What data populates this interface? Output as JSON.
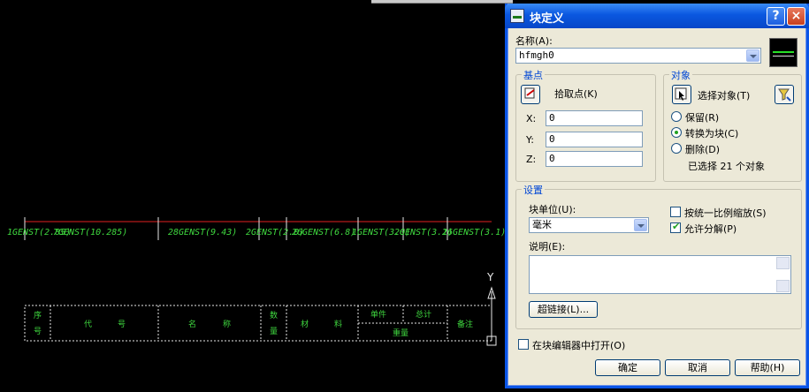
{
  "dialog": {
    "title": "块定义",
    "help_glyph": "?",
    "close_glyph": "×",
    "name_label": "名称(A):",
    "name_value": "hfmgh0",
    "base_point": {
      "title": "基点",
      "pick_label": "拾取点(K)",
      "x_label": "X:",
      "x_value": "0",
      "y_label": "Y:",
      "y_value": "0",
      "z_label": "Z:",
      "z_value": "0"
    },
    "objects": {
      "title": "对象",
      "select_label": "选择对象(T)",
      "retain": "保留(R)",
      "convert": "转换为块(C)",
      "delete": "删除(D)",
      "selected": "已选择 21 个对象"
    },
    "settings": {
      "title": "设置",
      "unit_label": "块单位(U):",
      "unit_value": "毫米",
      "description_label": "说明(E):",
      "hyperlink_button": "超链接(L)...",
      "uniform_scale": "按统一比例缩放(S)",
      "allow_explode": "允许分解(P)"
    },
    "open_in_editor": "在块编辑器中打开(O)",
    "ok": "确定",
    "cancel": "取消",
    "help": "帮助(H)"
  },
  "cad": {
    "gens": [
      "1GENST(2.85)",
      "7GENST(10.285)",
      "28GENST(9.43)",
      "2GENST(2.0)",
      "26GENST(6.8)",
      "1GENST(3.0)",
      "2GENST(3.1)",
      "26GENST(3.1)"
    ],
    "table_labels": [
      "序",
      "号",
      "代",
      "号",
      "名",
      "称",
      "数",
      "量",
      "材",
      "料",
      "单件",
      "总计",
      "重量",
      "备注"
    ],
    "ucs_y": "Y"
  },
  "colors": {
    "cad_background": "#000000",
    "cad_green": "#3fd83f",
    "cad_red": "#e02020",
    "dialog_face": "#ece9d8",
    "titlebar_blue": "#0a57e0"
  }
}
